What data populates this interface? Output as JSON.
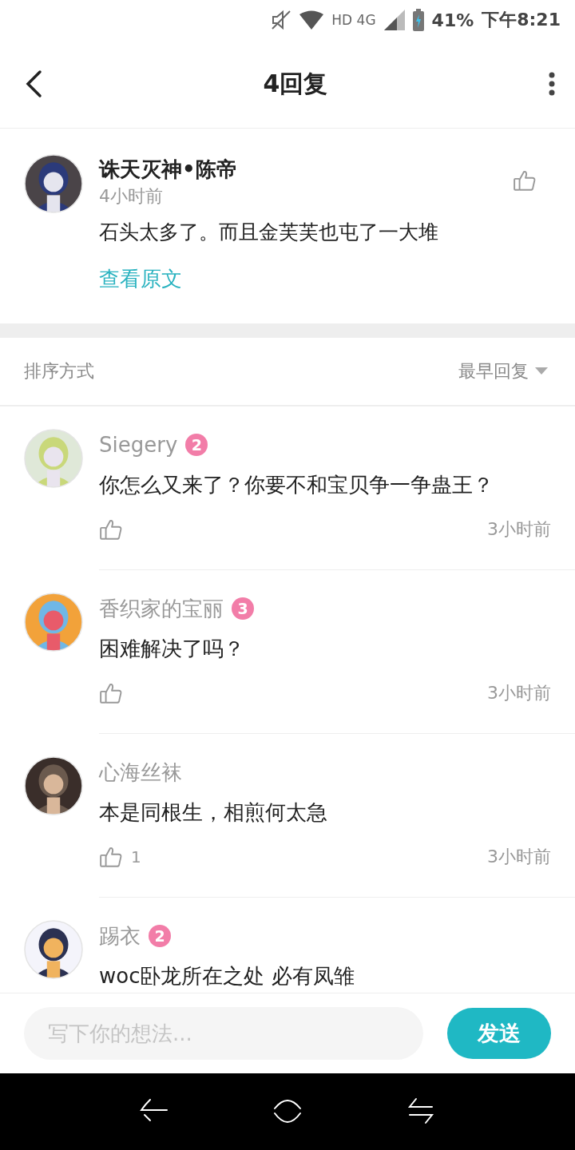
{
  "status_bar": {
    "network": "HD 4G",
    "battery": "41%",
    "time": "下午8:21"
  },
  "header": {
    "title": "4回复"
  },
  "post": {
    "author": "诛天灭神•陈帝",
    "time": "4小时前",
    "text": "石头太多了。而且金芙芙也屯了一大堆",
    "link": "查看原文"
  },
  "sort": {
    "label": "排序方式",
    "value": "最早回复"
  },
  "replies": [
    {
      "author": "Siegery",
      "level": "2",
      "text": "你怎么又来了？你要不和宝贝争一争蛊王？",
      "time": "3小时前"
    },
    {
      "author": "香织家的宝丽",
      "level": "3",
      "text": "困难解决了吗？",
      "time": "3小时前"
    },
    {
      "author": "心海丝袜",
      "text": "本是同根生，相煎何太急",
      "likes": "1",
      "time": "3小时前"
    },
    {
      "author": "踢衣",
      "level": "2",
      "text": "woc卧龙所在之处 必有凤雏"
    }
  ],
  "composer": {
    "placeholder": "写下你的想法...",
    "send": "发送"
  }
}
